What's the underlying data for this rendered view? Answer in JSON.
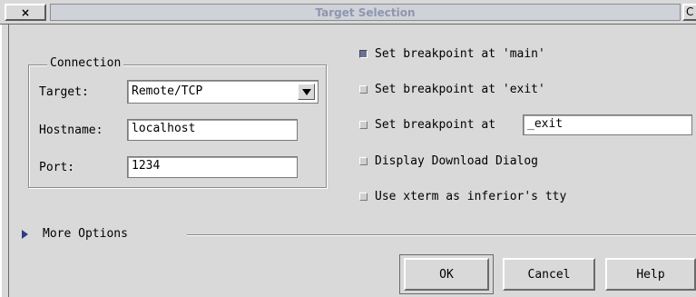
{
  "window": {
    "title": "Target Selection",
    "close_label": "×",
    "right_button_label": "C"
  },
  "connection": {
    "group_label": "Connection",
    "target_label": "Target:",
    "target_value": "Remote/TCP",
    "hostname_label": "Hostname:",
    "hostname_value": "localhost",
    "port_label": "Port:",
    "port_value": "1234"
  },
  "options": [
    {
      "label": "Set breakpoint at 'main'",
      "checked": true
    },
    {
      "label": "Set breakpoint at 'exit'",
      "checked": false
    },
    {
      "label": "Set breakpoint at",
      "checked": false,
      "field_value": "_exit"
    },
    {
      "label": "Display Download Dialog",
      "checked": false
    },
    {
      "label": "Use xterm as inferior's tty",
      "checked": false
    }
  ],
  "more_options_label": "More Options",
  "buttons": {
    "ok": "OK",
    "cancel": "Cancel",
    "help": "Help"
  }
}
